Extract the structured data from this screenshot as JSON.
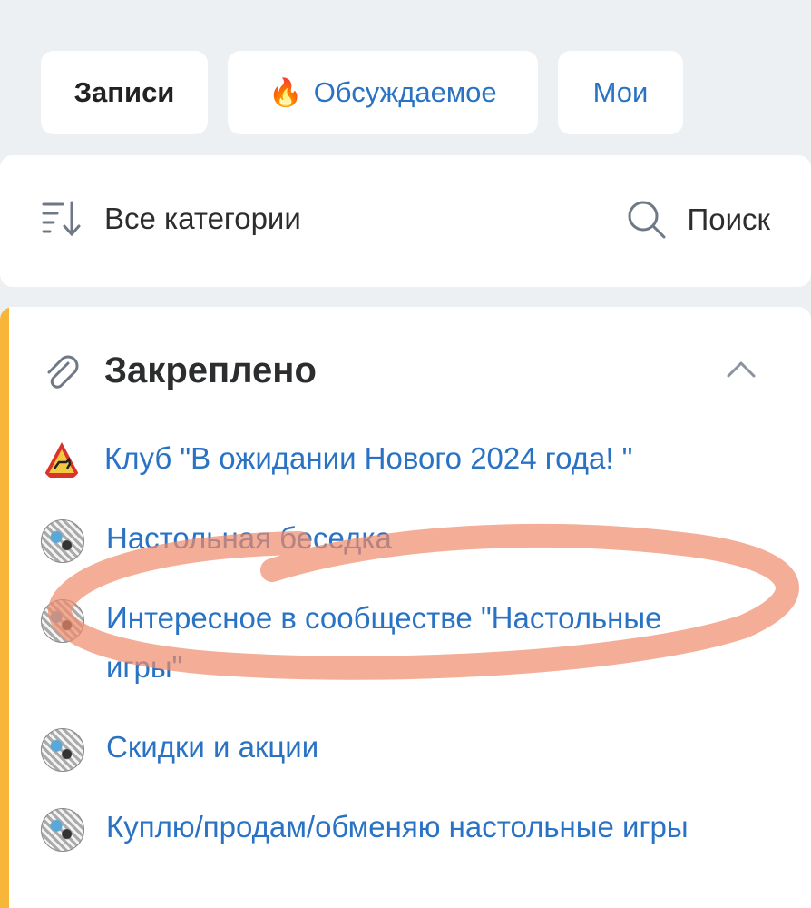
{
  "tabs": {
    "records": "Записи",
    "hot_icon": "🔥",
    "hot": "Обсуждаемое",
    "mine": "Мои"
  },
  "filter": {
    "categories": "Все категории",
    "search": "Поиск"
  },
  "pinned": {
    "title": "Закреплено",
    "items": [
      {
        "label": "Клуб \"В ожидании Нового 2024 года! \"",
        "icon": "warning-sign-avatar"
      },
      {
        "label": "Настольная беседка",
        "icon": "dice-avatar"
      },
      {
        "label": "Интересное в сообществе \"Настольные игры\"",
        "icon": "dice-avatar"
      },
      {
        "label": "Скидки и акции",
        "icon": "dice-avatar"
      },
      {
        "label": "Куплю/продам/обменяю настольные игры",
        "icon": "dice-avatar"
      }
    ]
  },
  "colors": {
    "link": "#2a73c4",
    "accent": "#f7b53a",
    "annotation": "#f08a6a"
  }
}
